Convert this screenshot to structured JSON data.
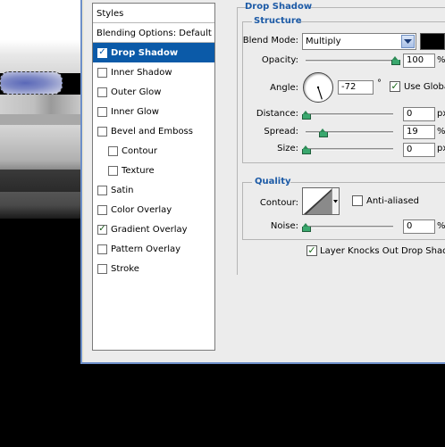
{
  "styles_list": {
    "header": "Styles",
    "blending_options": "Blending Options: Default",
    "items": [
      {
        "label": "Drop Shadow",
        "checked": true,
        "selected": true,
        "sub": false
      },
      {
        "label": "Inner Shadow",
        "checked": false,
        "selected": false,
        "sub": false
      },
      {
        "label": "Outer Glow",
        "checked": false,
        "selected": false,
        "sub": false
      },
      {
        "label": "Inner Glow",
        "checked": false,
        "selected": false,
        "sub": false
      },
      {
        "label": "Bevel and Emboss",
        "checked": false,
        "selected": false,
        "sub": false
      },
      {
        "label": "Contour",
        "checked": false,
        "selected": false,
        "sub": true
      },
      {
        "label": "Texture",
        "checked": false,
        "selected": false,
        "sub": true
      },
      {
        "label": "Satin",
        "checked": false,
        "selected": false,
        "sub": false
      },
      {
        "label": "Color Overlay",
        "checked": false,
        "selected": false,
        "sub": false
      },
      {
        "label": "Gradient Overlay",
        "checked": true,
        "selected": false,
        "sub": false
      },
      {
        "label": "Pattern Overlay",
        "checked": false,
        "selected": false,
        "sub": false
      },
      {
        "label": "Stroke",
        "checked": false,
        "selected": false,
        "sub": false
      }
    ]
  },
  "panel": {
    "title": "Drop Shadow",
    "structure": {
      "title": "Structure",
      "blend_mode": {
        "label": "Blend Mode:",
        "value": "Multiply"
      },
      "shadow_color": "#000000",
      "opacity": {
        "label": "Opacity:",
        "value": "100",
        "unit": "%",
        "slider_fraction": 1.0
      },
      "angle": {
        "label": "Angle:",
        "value": "-72",
        "unit": "°",
        "degrees": -72
      },
      "use_global_light": "Use Global Light",
      "distance": {
        "label": "Distance:",
        "value": "0",
        "unit": "px",
        "slider_fraction": 0.0
      },
      "spread": {
        "label": "Spread:",
        "value": "19",
        "unit": "%",
        "slider_fraction": 0.19
      },
      "size": {
        "label": "Size:",
        "value": "0",
        "unit": "px",
        "slider_fraction": 0.0
      }
    },
    "quality": {
      "title": "Quality",
      "contour_label": "Contour:",
      "anti_aliased": "Anti-aliased",
      "noise": {
        "label": "Noise:",
        "value": "0",
        "unit": "%",
        "slider_fraction": 0.0
      }
    },
    "layer_knocks_out": "Layer Knocks Out Drop Shadow"
  },
  "colors": {
    "selection_blue": "#0b5aa8",
    "section_title_blue": "#1c5aa6",
    "dialog_background": "#ececec",
    "slider_thumb_green": "#3aa86e"
  }
}
